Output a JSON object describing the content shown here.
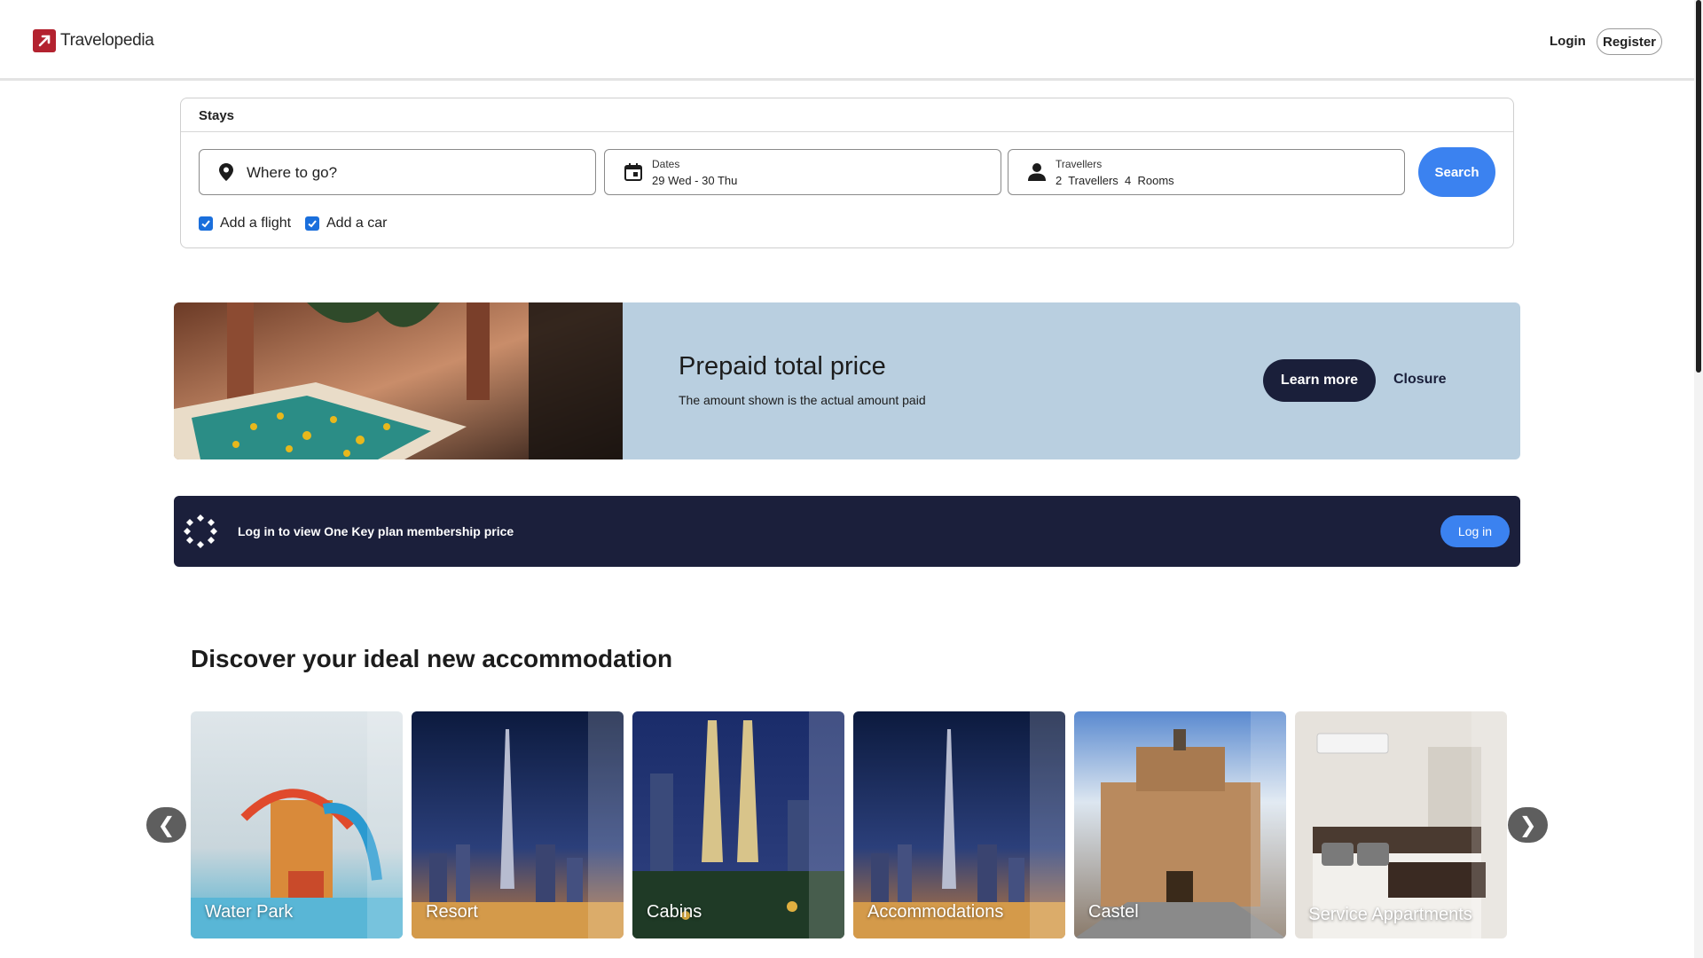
{
  "header": {
    "brand": "Travelopedia",
    "login_label": "Login",
    "register_label": "Register"
  },
  "search": {
    "tab_label": "Stays",
    "where_placeholder": "Where to go?",
    "dates_label": "Dates",
    "dates_value": "29 Wed - 30 Thu",
    "travellers_label": "Travellers",
    "travellers_value": "2  Travellers  4  Rooms",
    "search_label": "Search",
    "add_flight_label": "Add a flight",
    "add_flight_checked": true,
    "add_car_label": "Add a car",
    "add_car_checked": true
  },
  "promo": {
    "title": "Prepaid total price",
    "subtitle": "The amount shown is the actual amount paid",
    "learn_more_label": "Learn more",
    "closure_label": "Closure"
  },
  "member": {
    "text": "Log in to view One Key plan membership price",
    "login_label": "Log in"
  },
  "discover": {
    "title": "Discover your ideal new accommodation",
    "prev_glyph": "❮",
    "next_glyph": "❯",
    "cards": [
      {
        "label": "Water Park"
      },
      {
        "label": "Resort"
      },
      {
        "label": "Cabins"
      },
      {
        "label": "Accommodations"
      },
      {
        "label": "Castel"
      },
      {
        "label": "Service Appartments"
      }
    ]
  },
  "colors": {
    "brand": "#b3222f",
    "accent_blue": "#3b82f0",
    "navy": "#1b1f3b",
    "promo_bg": "#b9cfe0"
  }
}
